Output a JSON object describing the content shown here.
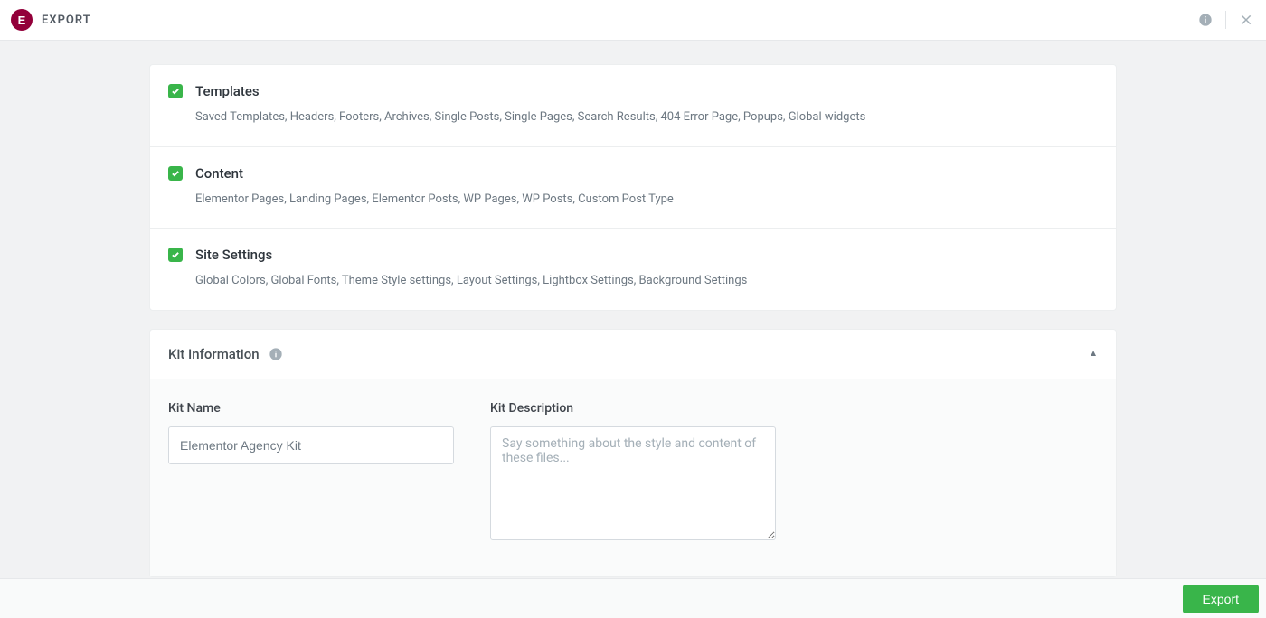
{
  "header": {
    "title": "EXPORT"
  },
  "options": [
    {
      "title": "Templates",
      "description": "Saved Templates, Headers, Footers, Archives, Single Posts, Single Pages, Search Results, 404 Error Page, Popups, Global widgets",
      "checked": true
    },
    {
      "title": "Content",
      "description": "Elementor Pages, Landing Pages, Elementor Posts, WP Pages, WP Posts, Custom Post Type",
      "checked": true
    },
    {
      "title": "Site Settings",
      "description": "Global Colors, Global Fonts, Theme Style settings, Layout Settings, Lightbox Settings, Background Settings",
      "checked": true
    }
  ],
  "kit": {
    "section_title": "Kit Information",
    "name_label": "Kit Name",
    "name_value": "Elementor Agency Kit",
    "desc_label": "Kit Description",
    "desc_value": "",
    "desc_placeholder": "Say something about the style and content of these files..."
  },
  "footer": {
    "export_label": "Export"
  }
}
